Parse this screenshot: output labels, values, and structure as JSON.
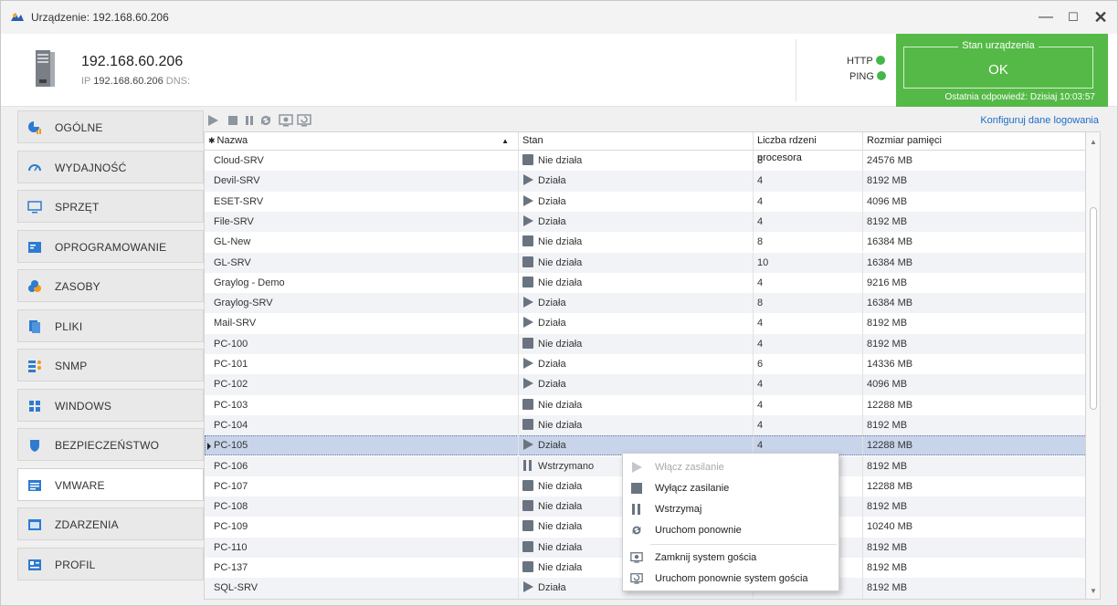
{
  "window": {
    "title": "Urządzenie: 192.168.60.206"
  },
  "header": {
    "ip": "192.168.60.206",
    "ip_label": "IP",
    "ip_value": "192.168.60.206",
    "dns_label": "DNS:",
    "http": "HTTP",
    "ping": "PING",
    "status_legend": "Stan urządzenia",
    "status_value": "OK",
    "last_response": "Ostatnia odpowiedź: Dzisiaj 10:03:57"
  },
  "sidebar": {
    "items": [
      {
        "label": "OGÓLNE",
        "icon": "chart-pie-icon"
      },
      {
        "label": "WYDAJNOŚĆ",
        "icon": "gauge-icon"
      },
      {
        "label": "SPRZĘT",
        "icon": "monitor-icon"
      },
      {
        "label": "OPROGRAMOWANIE",
        "icon": "software-icon"
      },
      {
        "label": "ZASOBY",
        "icon": "resources-icon"
      },
      {
        "label": "PLIKI",
        "icon": "files-icon"
      },
      {
        "label": "SNMP",
        "icon": "snmp-icon"
      },
      {
        "label": "WINDOWS",
        "icon": "windows-icon"
      },
      {
        "label": "BEZPIECZEŃSTWO",
        "icon": "shield-icon"
      },
      {
        "label": "VMWARE",
        "icon": "vmware-icon"
      },
      {
        "label": "ZDARZENIA",
        "icon": "events-icon"
      },
      {
        "label": "PROFIL",
        "icon": "profile-icon"
      }
    ],
    "active": "VMWARE"
  },
  "toolbar": {
    "config_link": "Konfiguruj dane logowania"
  },
  "table": {
    "columns": [
      "Nazwa",
      "Stan",
      "Liczba rdzeni procesora",
      "Rozmiar pamięci"
    ],
    "sort_indicator": "▲",
    "rows": [
      {
        "name": "Cloud-SRV",
        "state": "Nie działa",
        "state_type": "stopped",
        "cores": "8",
        "memory": "24576 MB"
      },
      {
        "name": "Devil-SRV",
        "state": "Działa",
        "state_type": "running",
        "cores": "4",
        "memory": "8192 MB"
      },
      {
        "name": "ESET-SRV",
        "state": "Działa",
        "state_type": "running",
        "cores": "4",
        "memory": "4096 MB"
      },
      {
        "name": "File-SRV",
        "state": "Działa",
        "state_type": "running",
        "cores": "4",
        "memory": "8192 MB"
      },
      {
        "name": "GL-New",
        "state": "Nie działa",
        "state_type": "stopped",
        "cores": "8",
        "memory": "16384 MB"
      },
      {
        "name": "GL-SRV",
        "state": "Nie działa",
        "state_type": "stopped",
        "cores": "10",
        "memory": "16384 MB"
      },
      {
        "name": "Graylog - Demo",
        "state": "Nie działa",
        "state_type": "stopped",
        "cores": "4",
        "memory": "9216 MB"
      },
      {
        "name": "Graylog-SRV",
        "state": "Działa",
        "state_type": "running",
        "cores": "8",
        "memory": "16384 MB"
      },
      {
        "name": "Mail-SRV",
        "state": "Działa",
        "state_type": "running",
        "cores": "4",
        "memory": "8192 MB"
      },
      {
        "name": "PC-100",
        "state": "Nie działa",
        "state_type": "stopped",
        "cores": "4",
        "memory": "8192 MB"
      },
      {
        "name": "PC-101",
        "state": "Działa",
        "state_type": "running",
        "cores": "6",
        "memory": "14336 MB"
      },
      {
        "name": "PC-102",
        "state": "Działa",
        "state_type": "running",
        "cores": "4",
        "memory": "4096 MB"
      },
      {
        "name": "PC-103",
        "state": "Nie działa",
        "state_type": "stopped",
        "cores": "4",
        "memory": "12288 MB"
      },
      {
        "name": "PC-104",
        "state": "Nie działa",
        "state_type": "stopped",
        "cores": "4",
        "memory": "8192 MB"
      },
      {
        "name": "PC-105",
        "state": "Działa",
        "state_type": "running",
        "cores": "4",
        "memory": "12288 MB",
        "selected": true
      },
      {
        "name": "PC-106",
        "state": "Wstrzymano",
        "state_type": "paused",
        "cores": "",
        "memory": "8192 MB"
      },
      {
        "name": "PC-107",
        "state": "Nie działa",
        "state_type": "stopped",
        "cores": "",
        "memory": "12288 MB"
      },
      {
        "name": "PC-108",
        "state": "Nie działa",
        "state_type": "stopped",
        "cores": "",
        "memory": "8192 MB"
      },
      {
        "name": "PC-109",
        "state": "Nie działa",
        "state_type": "stopped",
        "cores": "",
        "memory": "10240 MB"
      },
      {
        "name": "PC-110",
        "state": "Nie działa",
        "state_type": "stopped",
        "cores": "",
        "memory": "8192 MB"
      },
      {
        "name": "PC-137",
        "state": "Nie działa",
        "state_type": "stopped",
        "cores": "",
        "memory": "8192 MB"
      },
      {
        "name": "SQL-SRV",
        "state": "Działa",
        "state_type": "running",
        "cores": "4",
        "memory": "8192 MB"
      }
    ]
  },
  "context_menu": {
    "items": [
      {
        "label": "Włącz zasilanie",
        "icon": "play-icon",
        "disabled": true
      },
      {
        "label": "Wyłącz zasilanie",
        "icon": "stop-icon",
        "disabled": false
      },
      {
        "label": "Wstrzymaj",
        "icon": "pause-icon",
        "disabled": false
      },
      {
        "label": "Uruchom ponownie",
        "icon": "refresh-icon",
        "disabled": false
      },
      {
        "label": "Zamknij system gościa",
        "icon": "guest-shutdown-icon",
        "disabled": false
      },
      {
        "label": "Uruchom ponownie system gościa",
        "icon": "guest-restart-icon",
        "disabled": false
      }
    ]
  },
  "colors": {
    "accent_green": "#55b947",
    "link_blue": "#1c6cc9",
    "icon_gray": "#6a7480",
    "selection": "#c7d4ea"
  }
}
